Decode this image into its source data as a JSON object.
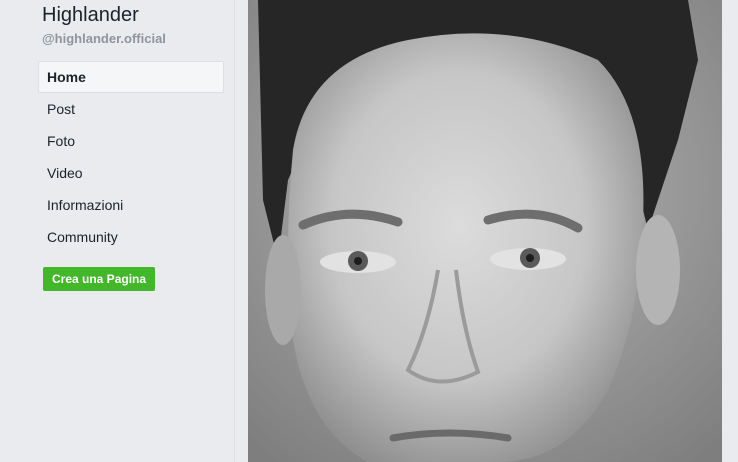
{
  "profile": {
    "name": "Highlander",
    "handle": "@highlander.official"
  },
  "nav": {
    "items": [
      {
        "label": "Home",
        "active": true
      },
      {
        "label": "Post",
        "active": false
      },
      {
        "label": "Foto",
        "active": false
      },
      {
        "label": "Video",
        "active": false
      },
      {
        "label": "Informazioni",
        "active": false
      },
      {
        "label": "Community",
        "active": false
      }
    ]
  },
  "actions": {
    "create_page_label": "Crea una Pagina"
  },
  "cover": {
    "description_icon": "portrait-photo"
  },
  "colors": {
    "sidebar_bg": "#e9ebee",
    "active_item_bg": "#f5f6f7",
    "create_button": "#42b72a",
    "text": "#1d2129",
    "muted_text": "#90949c"
  }
}
